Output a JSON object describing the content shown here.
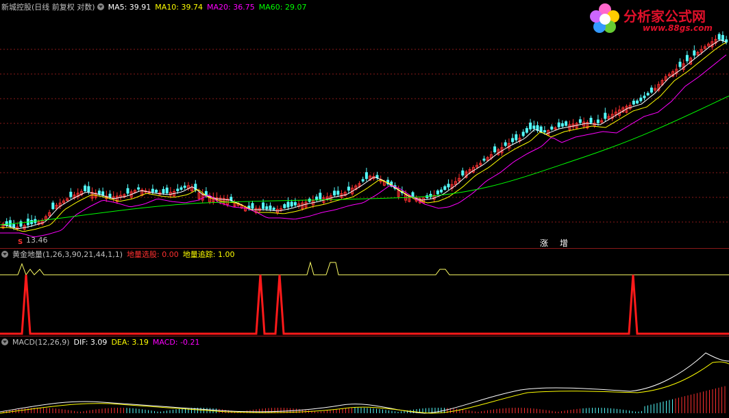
{
  "main": {
    "title": "新城控股(日线 前复权 对数)",
    "ma5": "MA5: 39.91",
    "ma10": "MA10: 39.74",
    "ma20": "MA20: 36.75",
    "ma60": "MA60: 29.07",
    "low_label": "13.46",
    "marker_s": "S",
    "marker_zhang": "涨",
    "marker_zeng": "增",
    "colors": {
      "ma5": "#ffffff",
      "ma10": "#ffff00",
      "ma20": "#ff00ff",
      "ma60": "#00ff00",
      "up": "#ff3030",
      "down": "#54fcfc",
      "grid": "#8b1a1a"
    }
  },
  "logo": {
    "name": "分析家公式网",
    "url": "www.88gs.com"
  },
  "indicator": {
    "title": "黄金地量(1,26,3,90,21,44,1,1)",
    "select": "地量选股: 0.00",
    "track": "地量追踪: 1.00"
  },
  "macd": {
    "title": "MACD(12,26,9)",
    "dif": "DIF: 3.09",
    "dea": "DEA: 3.19",
    "macd": "MACD: -0.21"
  }
}
